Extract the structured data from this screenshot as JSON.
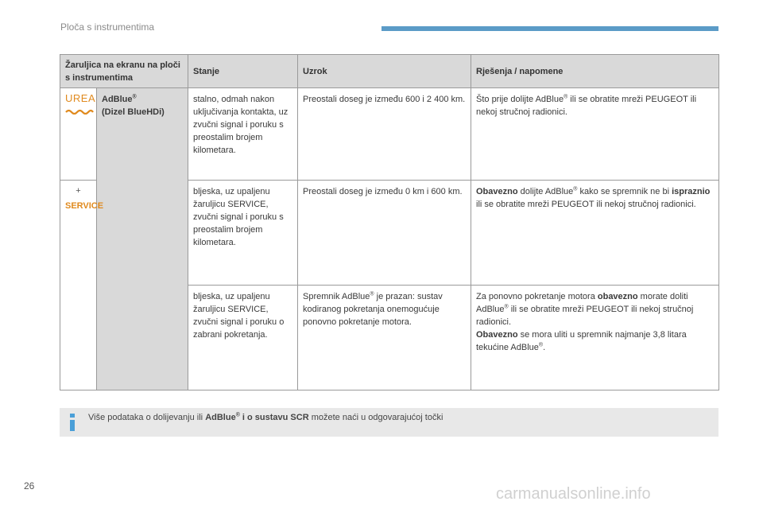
{
  "header": {
    "chapter": "Ploča s instrumentima"
  },
  "table": {
    "columns": [
      "Žaruljica na ekranu na ploči s instrumentima",
      "Stanje",
      "Uzrok",
      "Rješenja / napomene"
    ],
    "icon_urea": "UREA",
    "icon_plus": "+",
    "icon_service": "SERVICE",
    "name_line1": "AdBlue",
    "name_sup": "®",
    "name_line2": "(Dizel BlueHDi)",
    "rows": [
      {
        "stanje": "stalno, odmah nakon uključivanja kontakta, uz zvučni signal i poruku s preostalim brojem kilometara.",
        "uzrok": "Preostali doseg je između 600 i 2 400 km.",
        "rj_a": "Što prije dolijte AdBlue",
        "rj_sup": "®",
        "rj_b": " ili se obratite mreži PEUGEOT ili nekoj stručnoj radionici."
      },
      {
        "stanje": "bljeska, uz upaljenu žaruljicu SERVICE, zvučni signal i poruku s preostalim brojem kilometara.",
        "uzrok": "Preostali doseg je između 0 km i 600 km.",
        "rj_b1": "Obavezno",
        "rj_a": " dolijte AdBlue",
        "rj_sup": "®",
        "rj_c": " kako se spremnik ne bi ",
        "rj_b2": "ispraznio",
        "rj_d": " ili se obratite mreži PEUGEOT ili nekoj stručnoj radionici."
      },
      {
        "stanje": "bljeska, uz upaljenu žaruljicu SERVICE, zvučni signal i poruku o zabrani pokretanja.",
        "uzrok_a": "Spremnik AdBlue",
        "uzrok_sup": "®",
        "uzrok_b": " je prazan: sustav kodiranog pokretanja onemogućuje ponovno pokretanje motora.",
        "rj_a": "Za ponovno pokretanje motora ",
        "rj_b1": "obavezno",
        "rj_c": " morate doliti AdBlue",
        "rj_sup": "®",
        "rj_d": " ili se obratite mreži PEUGEOT ili nekoj stručnoj radionici.",
        "rj_b2": "Obavezno",
        "rj_e": " se mora uliti u spremnik najmanje 3,8 litara tekućine AdBlue",
        "rj_sup2": "®",
        "rj_f": "."
      }
    ]
  },
  "info": {
    "text_a": "Više podataka o dolijevanju ili ",
    "bold_a": "AdBlue",
    "sup": "®",
    "bold_b": " i o sustavu SCR",
    "text_b": " možete naći u odgovarajućoj točki"
  },
  "footer": {
    "page_number": "26",
    "watermark": "carmanualsonline.info"
  }
}
